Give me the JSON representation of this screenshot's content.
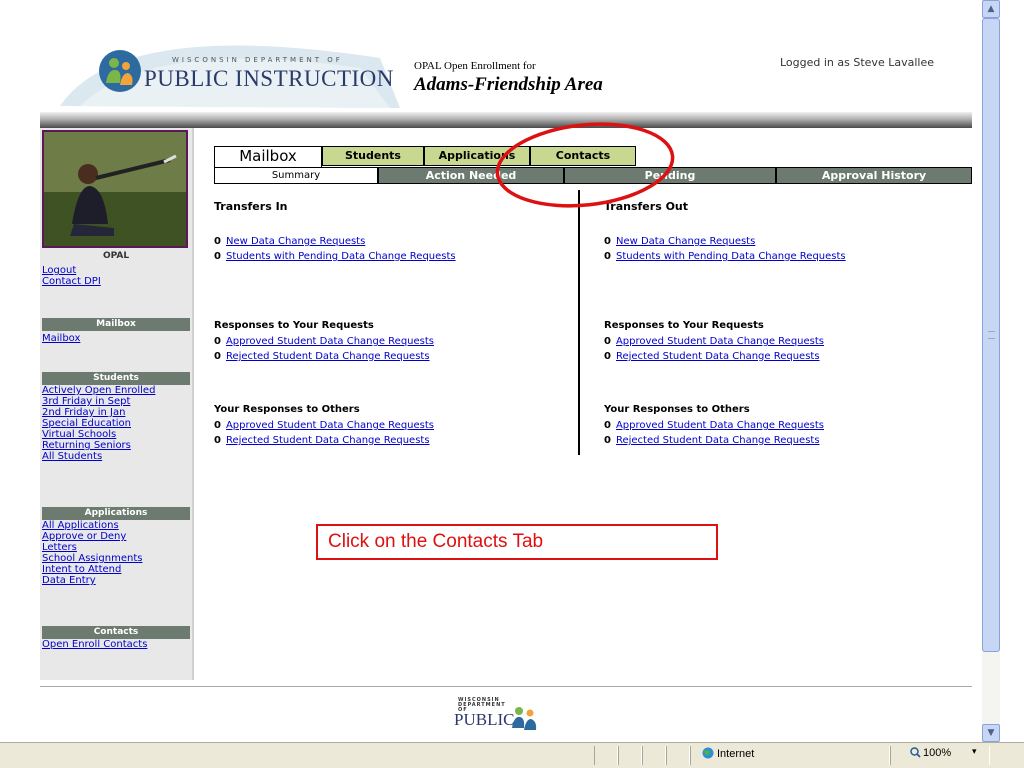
{
  "header": {
    "logo_small": "WISCONSIN DEPARTMENT OF",
    "logo_big": "PUBLIC INSTRUCTION",
    "opal_line1": "OPAL Open Enrollment for",
    "opal_line2": "Adams-Friendship Area",
    "logged_in": "Logged in as Steve Lavallee"
  },
  "sidebar": {
    "opal_heading": "OPAL",
    "top_links": [
      "Logout",
      "Contact DPI"
    ],
    "sections": [
      {
        "heading": "Mailbox",
        "links": [
          "Mailbox"
        ]
      },
      {
        "heading": "Students",
        "links": [
          "Actively Open Enrolled",
          "3rd Friday in Sept",
          "2nd Friday in Jan",
          "Special Education",
          "Virtual Schools",
          "Returning Seniors",
          "All Students"
        ]
      },
      {
        "heading": "Applications",
        "links": [
          "All Applications",
          "Approve or Deny",
          "Letters",
          "School Assignments",
          "Intent to Attend",
          "Data Entry"
        ]
      },
      {
        "heading": "Contacts",
        "links": [
          "Open Enroll Contacts"
        ]
      }
    ]
  },
  "tabs": {
    "mailbox": "Mailbox",
    "students": "Students",
    "applications": "Applications",
    "contacts": "Contacts"
  },
  "subtabs": {
    "summary": "Summary",
    "action_needed": "Action Needed",
    "pending": "Pending",
    "approval_history": "Approval History"
  },
  "transfers_in": {
    "title": "Transfers In",
    "rows": [
      {
        "count": "0",
        "label": "New Data Change Requests"
      },
      {
        "count": "0",
        "label": "Students with Pending Data Change Requests"
      }
    ],
    "responses_title": "Responses to Your Requests",
    "responses": [
      {
        "count": "0",
        "label": "Approved Student Data Change Requests"
      },
      {
        "count": "0",
        "label": "Rejected Student Data Change Requests"
      }
    ],
    "others_title": "Your Responses to Others",
    "others": [
      {
        "count": "0",
        "label": "Approved Student Data Change Requests"
      },
      {
        "count": "0",
        "label": "Rejected Student Data Change Requests"
      }
    ]
  },
  "transfers_out": {
    "title": "Transfers Out",
    "rows": [
      {
        "count": "0",
        "label": "New Data Change Requests"
      },
      {
        "count": "0",
        "label": "Students with Pending Data Change Requests"
      }
    ],
    "responses_title": "Responses to Your Requests",
    "responses": [
      {
        "count": "0",
        "label": "Approved Student Data Change Requests"
      },
      {
        "count": "0",
        "label": "Rejected Student Data Change Requests"
      }
    ],
    "others_title": "Your Responses to Others",
    "others": [
      {
        "count": "0",
        "label": "Approved Student Data Change Requests"
      },
      {
        "count": "0",
        "label": "Rejected Student Data Change Requests"
      }
    ]
  },
  "callout": {
    "text": "Click on the Contacts Tab",
    "color": "#dd1111"
  },
  "footer": {
    "logo_small": "WISCONSIN DEPARTMENT OF",
    "logo_big": "PUBLIC"
  },
  "statusbar": {
    "zone": "Internet",
    "zoom": "100%"
  },
  "colors": {
    "tab_green": "#c8d890",
    "sidebar_heading": "#6d7a70",
    "link": "#0000cc",
    "photo_border": "#5a1a5a"
  },
  "icons": {
    "zone": "globe-icon",
    "zoom": "magnifier-icon"
  }
}
